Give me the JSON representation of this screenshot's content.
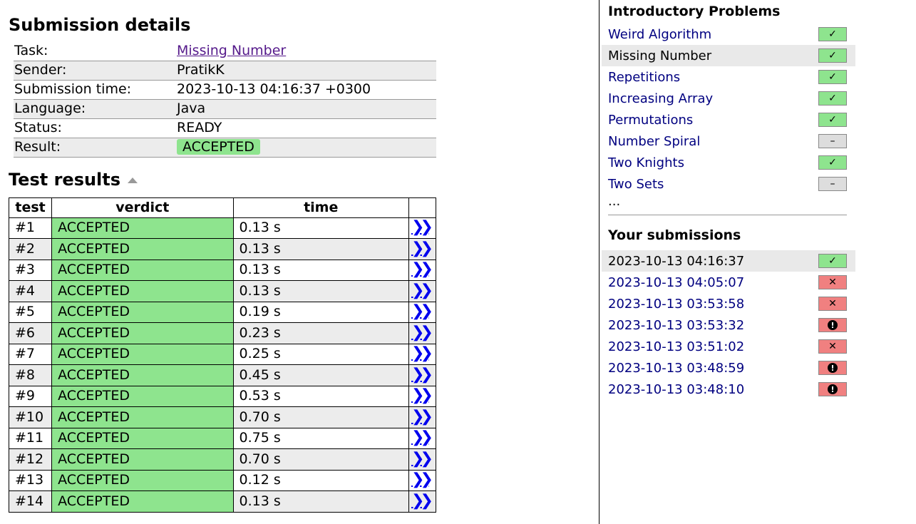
{
  "details": {
    "title": "Submission details",
    "rows": [
      {
        "key": "Task:",
        "value": "Missing Number"
      },
      {
        "key": "Sender:",
        "value": "PratikK"
      },
      {
        "key": "Submission time:",
        "value": "2023-10-13 04:16:37 +0300"
      },
      {
        "key": "Language:",
        "value": "Java"
      },
      {
        "key": "Status:",
        "value": "READY"
      },
      {
        "key": "Result:",
        "value": "ACCEPTED"
      }
    ]
  },
  "results": {
    "title": "Test results",
    "headers": {
      "test": "test",
      "verdict": "verdict",
      "time": "time"
    },
    "rows": [
      {
        "test": "#1",
        "verdict": "ACCEPTED",
        "time": "0.13 s"
      },
      {
        "test": "#2",
        "verdict": "ACCEPTED",
        "time": "0.13 s"
      },
      {
        "test": "#3",
        "verdict": "ACCEPTED",
        "time": "0.13 s"
      },
      {
        "test": "#4",
        "verdict": "ACCEPTED",
        "time": "0.13 s"
      },
      {
        "test": "#5",
        "verdict": "ACCEPTED",
        "time": "0.19 s"
      },
      {
        "test": "#6",
        "verdict": "ACCEPTED",
        "time": "0.23 s"
      },
      {
        "test": "#7",
        "verdict": "ACCEPTED",
        "time": "0.25 s"
      },
      {
        "test": "#8",
        "verdict": "ACCEPTED",
        "time": "0.45 s"
      },
      {
        "test": "#9",
        "verdict": "ACCEPTED",
        "time": "0.53 s"
      },
      {
        "test": "#10",
        "verdict": "ACCEPTED",
        "time": "0.70 s"
      },
      {
        "test": "#11",
        "verdict": "ACCEPTED",
        "time": "0.75 s"
      },
      {
        "test": "#12",
        "verdict": "ACCEPTED",
        "time": "0.70 s"
      },
      {
        "test": "#13",
        "verdict": "ACCEPTED",
        "time": "0.12 s"
      },
      {
        "test": "#14",
        "verdict": "ACCEPTED",
        "time": "0.13 s"
      }
    ],
    "view_icon": "double-chevron-right-icon"
  },
  "sidebar": {
    "problems_title": "Introductory Problems",
    "problems": [
      {
        "name": "Weird Algorithm",
        "status": "ok",
        "current": false
      },
      {
        "name": "Missing Number",
        "status": "ok",
        "current": true
      },
      {
        "name": "Repetitions",
        "status": "ok",
        "current": false
      },
      {
        "name": "Increasing Array",
        "status": "ok",
        "current": false
      },
      {
        "name": "Permutations",
        "status": "ok",
        "current": false
      },
      {
        "name": "Number Spiral",
        "status": "none",
        "current": false
      },
      {
        "name": "Two Knights",
        "status": "ok",
        "current": false
      },
      {
        "name": "Two Sets",
        "status": "none",
        "current": false
      }
    ],
    "more": "...",
    "submissions_title": "Your submissions",
    "submissions": [
      {
        "time": "2023-10-13 04:16:37",
        "status": "ok",
        "current": true
      },
      {
        "time": "2023-10-13 04:05:07",
        "status": "bad",
        "current": false
      },
      {
        "time": "2023-10-13 03:53:58",
        "status": "bad",
        "current": false
      },
      {
        "time": "2023-10-13 03:53:32",
        "status": "err",
        "current": false
      },
      {
        "time": "2023-10-13 03:51:02",
        "status": "bad",
        "current": false
      },
      {
        "time": "2023-10-13 03:48:59",
        "status": "err",
        "current": false
      },
      {
        "time": "2023-10-13 03:48:10",
        "status": "err",
        "current": false
      }
    ]
  },
  "colors": {
    "accepted": "#8ee48e",
    "failed": "#f08080",
    "none": "#dddddd",
    "link": "#000080",
    "visited_link": "#551a8b"
  }
}
